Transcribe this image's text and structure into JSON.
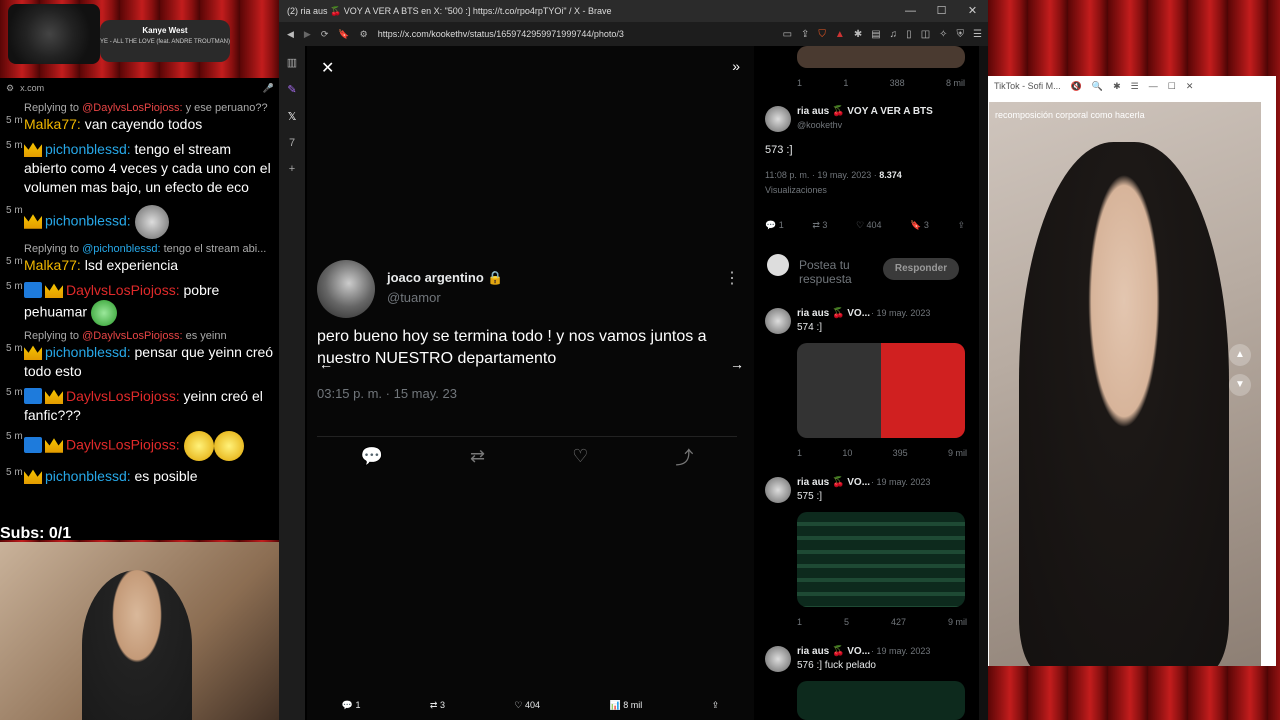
{
  "song": {
    "artist": "Kanye West",
    "title": "YE - ALL THE LOVE (feat. ANDRE TROUTMAN)"
  },
  "chat": {
    "url": "x.com",
    "messages": [
      {
        "reply_to": "@DaylvsLosPiojoss:",
        "reply_text": "y ese peruano??",
        "age": "5 m",
        "user": "Malka77:",
        "text": "van cayendo todos"
      },
      {
        "age": "5 m",
        "user": "pichonblessd:",
        "text": "tengo el stream abierto como 4 veces y cada uno con el volumen mas bajo, un efecto de eco"
      },
      {
        "age": "5 m",
        "user": "pichonblessd:",
        "text": ""
      },
      {
        "reply_to": "@pichonblessd:",
        "reply_text": "tengo el stream abi...",
        "age": "5 m",
        "user": "Malka77:",
        "text": "lsd experiencia"
      },
      {
        "age": "5 m",
        "user": "DaylvsLosPiojoss:",
        "text": "pobre pehuamar"
      },
      {
        "reply_to": "@DaylvsLosPiojoss:",
        "reply_text": "es yeinn",
        "age": "5 m",
        "user": "pichonblessd:",
        "text": "pensar que yeinn creó todo esto"
      },
      {
        "age": "5 m",
        "user": "DaylvsLosPiojoss:",
        "text": "yeinn creó el fanfic???"
      },
      {
        "age": "5 m",
        "user": "DaylvsLosPiojoss:",
        "text": ""
      },
      {
        "age": "5 m",
        "user": "pichonblessd:",
        "text": "es posible"
      }
    ],
    "reply_prefix": "Replying to"
  },
  "subs": "Subs: 0/1",
  "browser": {
    "title": "(2) ria aus 🍒 VOY A VER A BTS en X: \"500 :] https://t.co/rpo4rpTYOi\" / X - Brave",
    "url": "https://x.com/kookethv/status/1659742959971999744/photo/3"
  },
  "tweet": {
    "name": "joaco argentino",
    "handle": "@tuamor",
    "text": "pero bueno hoy se termina todo ! y nos vamos juntos a nuestro NUESTRO departamento",
    "time": "03:15 p. m. · 15 may. 23"
  },
  "bottom_stats": {
    "replies": "1",
    "retweets": "3",
    "likes": "404",
    "views": "8 mil"
  },
  "timeline": {
    "top_stats": {
      "replies": "1",
      "retweets": "1",
      "likes": "388",
      "views": "8 mil"
    },
    "main": {
      "name": "ria aus 🍒 VOY A VER A BTS",
      "handle": "@kookethv",
      "text": "573 :]",
      "time": "11:08 p. m. · 19 may. 2023 ·",
      "views": "8.374",
      "views_label": "Visualizaciones",
      "stats": {
        "replies": "1",
        "retweets": "3",
        "likes": "404",
        "bookmarks": "3"
      }
    },
    "reply_placeholder": "Postea tu respuesta",
    "reply_button": "Responder",
    "posts": [
      {
        "name": "ria aus 🍒 VO...",
        "date": "· 19 may. 2023",
        "text": "574 :]",
        "replies": "1",
        "retweets": "10",
        "likes": "395",
        "views": "9 mil"
      },
      {
        "name": "ria aus 🍒 VO...",
        "date": "· 19 may. 2023",
        "text": "575 :]",
        "replies": "1",
        "retweets": "5",
        "likes": "427",
        "views": "9 mil"
      },
      {
        "name": "ria aus 🍒 VO...",
        "date": "· 19 may. 2023",
        "text": "576 :] fuck pelado"
      }
    ]
  },
  "tiktok": {
    "title": "TikTok - Sofi M...",
    "search": "recomposición corporal como hacerla"
  }
}
